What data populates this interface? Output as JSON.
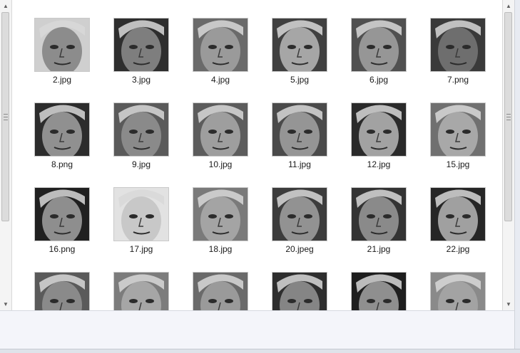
{
  "files": [
    {
      "name": "2.jpg",
      "tone": "#8c8c8c",
      "bg": "#cfcfcf"
    },
    {
      "name": "3.jpg",
      "tone": "#7e7e7e",
      "bg": "#2e2e2e"
    },
    {
      "name": "4.jpg",
      "tone": "#9a9a9a",
      "bg": "#6a6a6a"
    },
    {
      "name": "5.jpg",
      "tone": "#a6a6a6",
      "bg": "#404040"
    },
    {
      "name": "6.jpg",
      "tone": "#969696",
      "bg": "#505050"
    },
    {
      "name": "7.png",
      "tone": "#6e6e6e",
      "bg": "#3a3a3a"
    },
    {
      "name": "8.png",
      "tone": "#909090",
      "bg": "#2c2c2c"
    },
    {
      "name": "9.jpg",
      "tone": "#8a8a8a",
      "bg": "#5a5a5a"
    },
    {
      "name": "10.jpg",
      "tone": "#9e9e9e",
      "bg": "#5c5c5c"
    },
    {
      "name": "11.jpg",
      "tone": "#959595",
      "bg": "#4a4a4a"
    },
    {
      "name": "12.jpg",
      "tone": "#a2a2a2",
      "bg": "#2a2a2a"
    },
    {
      "name": "15.jpg",
      "tone": "#a8a8a8",
      "bg": "#707070"
    },
    {
      "name": "16.png",
      "tone": "#8e8e8e",
      "bg": "#202020"
    },
    {
      "name": "17.jpg",
      "tone": "#c8c8c8",
      "bg": "#e2e2e2"
    },
    {
      "name": "18.jpg",
      "tone": "#a4a4a4",
      "bg": "#7a7a7a"
    },
    {
      "name": "20.jpeg",
      "tone": "#929292",
      "bg": "#3c3c3c"
    },
    {
      "name": "21.jpg",
      "tone": "#8a8a8a",
      "bg": "#333333"
    },
    {
      "name": "22.jpg",
      "tone": "#a0a0a0",
      "bg": "#262626"
    },
    {
      "name": "",
      "tone": "#8a8a8a",
      "bg": "#5a5a5a"
    },
    {
      "name": "",
      "tone": "#a6a6a6",
      "bg": "#7c7c7c"
    },
    {
      "name": "",
      "tone": "#9a9a9a",
      "bg": "#6a6a6a"
    },
    {
      "name": "",
      "tone": "#858585",
      "bg": "#2e2e2e"
    },
    {
      "name": "",
      "tone": "#8f8f8f",
      "bg": "#1e1e1e"
    },
    {
      "name": "",
      "tone": "#a3a3a3",
      "bg": "#8a8a8a"
    }
  ],
  "icons": {
    "left_scroll_up": "arrow-up",
    "left_scroll_down": "arrow-down",
    "right_scroll_up": "arrow-up",
    "right_scroll_down": "arrow-down"
  }
}
